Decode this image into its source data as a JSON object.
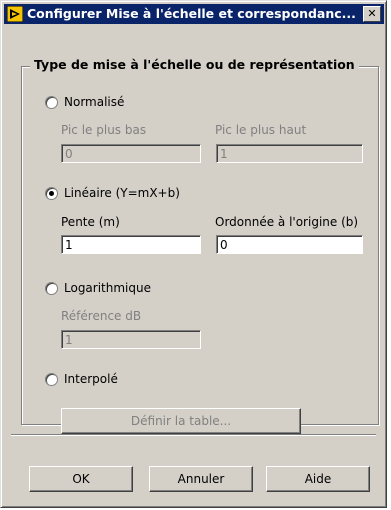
{
  "window": {
    "title": "Configurer Mise à l'échelle et correspondanc...",
    "close_glyph": "✕"
  },
  "group": {
    "title": "Type de mise à l'échelle ou de représentation"
  },
  "normalise": {
    "label": "Normalisé",
    "checked": false,
    "low_label": "Pic le plus bas",
    "low_value": "0",
    "high_label": "Pic le plus haut",
    "high_value": "1"
  },
  "lineaire": {
    "label": "Linéaire (Y=mX+b)",
    "checked": true,
    "slope_label": "Pente (m)",
    "slope_value": "1",
    "intercept_label": "Ordonnée à l'origine (b)",
    "intercept_value": "0"
  },
  "logarithmique": {
    "label": "Logarithmique",
    "checked": false,
    "ref_label": "Référence dB",
    "ref_value": "1"
  },
  "interpole": {
    "label": "Interpolé",
    "checked": false,
    "table_button": "Définir la table..."
  },
  "buttons": {
    "ok": "OK",
    "cancel": "Annuler",
    "help": "Aide"
  },
  "colors": {
    "titlebar": "#0a246a",
    "face": "#d4d0c8",
    "icon_bg": "#f5c400"
  }
}
